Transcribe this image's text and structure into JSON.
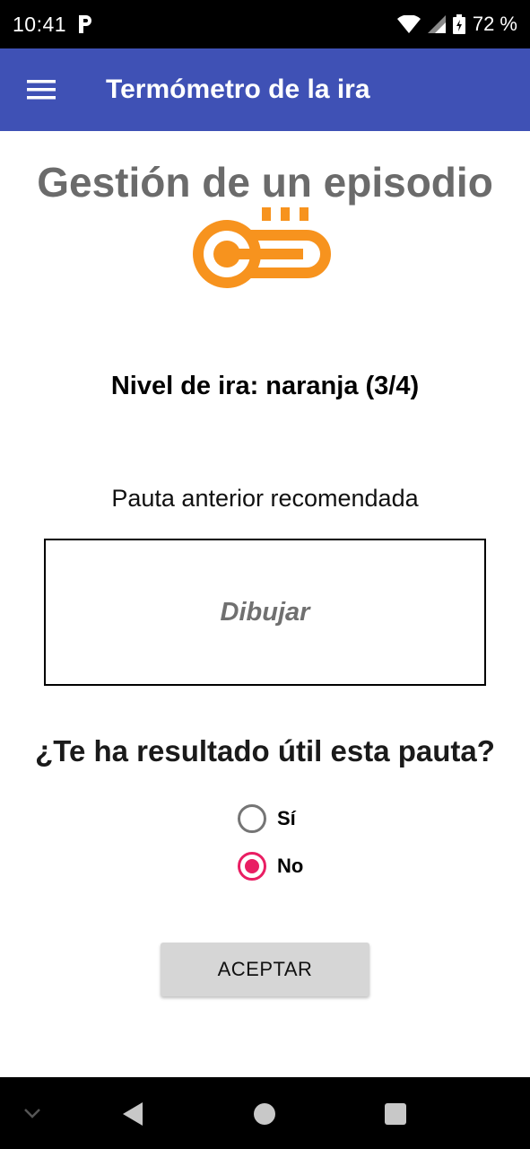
{
  "status_bar": {
    "time": "10:41",
    "battery": "72 %",
    "icons": [
      "parking-notification-icon",
      "wifi-icon",
      "cell-signal-icon",
      "battery-icon"
    ]
  },
  "app_bar": {
    "title": "Termómetro de la ira",
    "color": "#3f51b5"
  },
  "main": {
    "page_title": "Gestión de un episodio",
    "icon": "thermometer-icon",
    "icon_color": "#f7931e",
    "level_label": "Nivel de ira: naranja (3/4)",
    "previous_label": "Pauta anterior recomendada",
    "draw_text": "Dibujar",
    "question": "¿Te ha resultado útil esta pauta?",
    "options": [
      {
        "label": "Sí",
        "selected": false
      },
      {
        "label": "No",
        "selected": true
      }
    ],
    "accept_label": "ACEPTAR",
    "accent_color": "#e91e63"
  },
  "nav_bar": {
    "icons": [
      "chevron-down-icon",
      "back-icon",
      "home-icon",
      "recents-icon"
    ]
  }
}
